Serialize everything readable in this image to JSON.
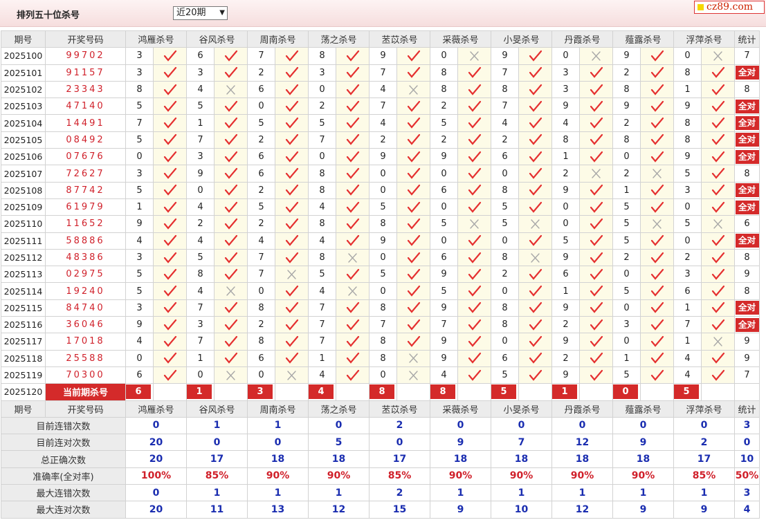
{
  "title": "排列五十位杀号",
  "period_select": {
    "value": "近20期",
    "options": [
      "近20期"
    ]
  },
  "site_badge": "cz89.com",
  "colors": {
    "accent": "#d42a2a",
    "draw_number": "#d0202a",
    "stat_value": "#1a2db0",
    "mark_bg": "#fdfbe7"
  },
  "headers": {
    "period": "期号",
    "draw": "开奖号码",
    "experts": [
      "鸿雁杀号",
      "谷风杀号",
      "周南杀号",
      "荡之杀号",
      "苤苡杀号",
      "采薇杀号",
      "小旻杀号",
      "丹霞杀号",
      "薤露杀号",
      "浮萍杀号"
    ],
    "count": "统计"
  },
  "rows": [
    {
      "period": "2025100",
      "draw": "99702",
      "kills": [
        3,
        6,
        7,
        8,
        9,
        0,
        9,
        0,
        9,
        0
      ],
      "hits": [
        1,
        1,
        1,
        1,
        1,
        0,
        1,
        0,
        1,
        0
      ],
      "count": "7"
    },
    {
      "period": "2025101",
      "draw": "91157",
      "kills": [
        3,
        3,
        2,
        3,
        7,
        8,
        7,
        3,
        2,
        8
      ],
      "hits": [
        1,
        1,
        1,
        1,
        1,
        1,
        1,
        1,
        1,
        1
      ],
      "count": "全对"
    },
    {
      "period": "2025102",
      "draw": "23343",
      "kills": [
        8,
        4,
        6,
        0,
        4,
        8,
        8,
        3,
        8,
        1
      ],
      "hits": [
        1,
        0,
        1,
        1,
        0,
        1,
        1,
        1,
        1,
        1
      ],
      "count": "8"
    },
    {
      "period": "2025103",
      "draw": "47140",
      "kills": [
        5,
        5,
        0,
        2,
        7,
        2,
        7,
        9,
        9,
        9
      ],
      "hits": [
        1,
        1,
        1,
        1,
        1,
        1,
        1,
        1,
        1,
        1
      ],
      "count": "全对"
    },
    {
      "period": "2025104",
      "draw": "14491",
      "kills": [
        7,
        1,
        5,
        5,
        4,
        5,
        4,
        4,
        2,
        8
      ],
      "hits": [
        1,
        1,
        1,
        1,
        1,
        1,
        1,
        1,
        1,
        1
      ],
      "count": "全对"
    },
    {
      "period": "2025105",
      "draw": "08492",
      "kills": [
        5,
        7,
        2,
        7,
        2,
        2,
        2,
        8,
        8,
        8
      ],
      "hits": [
        1,
        1,
        1,
        1,
        1,
        1,
        1,
        1,
        1,
        1
      ],
      "count": "全对"
    },
    {
      "period": "2025106",
      "draw": "07676",
      "kills": [
        0,
        3,
        6,
        0,
        9,
        9,
        6,
        1,
        0,
        9
      ],
      "hits": [
        1,
        1,
        1,
        1,
        1,
        1,
        1,
        1,
        1,
        1
      ],
      "count": "全对"
    },
    {
      "period": "2025107",
      "draw": "72627",
      "kills": [
        3,
        9,
        6,
        8,
        0,
        0,
        0,
        2,
        2,
        5
      ],
      "hits": [
        1,
        1,
        1,
        1,
        1,
        1,
        1,
        0,
        0,
        1
      ],
      "count": "8"
    },
    {
      "period": "2025108",
      "draw": "87742",
      "kills": [
        5,
        0,
        2,
        8,
        0,
        6,
        8,
        9,
        1,
        3
      ],
      "hits": [
        1,
        1,
        1,
        1,
        1,
        1,
        1,
        1,
        1,
        1
      ],
      "count": "全对"
    },
    {
      "period": "2025109",
      "draw": "61979",
      "kills": [
        1,
        4,
        5,
        4,
        5,
        0,
        5,
        0,
        5,
        0
      ],
      "hits": [
        1,
        1,
        1,
        1,
        1,
        1,
        1,
        1,
        1,
        1
      ],
      "count": "全对"
    },
    {
      "period": "2025110",
      "draw": "11652",
      "kills": [
        9,
        2,
        2,
        8,
        8,
        5,
        5,
        0,
        5,
        5
      ],
      "hits": [
        1,
        1,
        1,
        1,
        1,
        0,
        0,
        1,
        0,
        0
      ],
      "count": "6"
    },
    {
      "period": "2025111",
      "draw": "58886",
      "kills": [
        4,
        4,
        4,
        4,
        9,
        0,
        0,
        5,
        5,
        0
      ],
      "hits": [
        1,
        1,
        1,
        1,
        1,
        1,
        1,
        1,
        1,
        1
      ],
      "count": "全对"
    },
    {
      "period": "2025112",
      "draw": "48386",
      "kills": [
        3,
        5,
        7,
        8,
        0,
        6,
        8,
        9,
        2,
        2
      ],
      "hits": [
        1,
        1,
        1,
        0,
        1,
        1,
        0,
        1,
        1,
        1
      ],
      "count": "8"
    },
    {
      "period": "2025113",
      "draw": "02975",
      "kills": [
        5,
        8,
        7,
        5,
        5,
        9,
        2,
        6,
        0,
        3
      ],
      "hits": [
        1,
        1,
        0,
        1,
        1,
        1,
        1,
        1,
        1,
        1
      ],
      "count": "9"
    },
    {
      "period": "2025114",
      "draw": "19240",
      "kills": [
        5,
        4,
        0,
        4,
        0,
        5,
        0,
        1,
        5,
        6
      ],
      "hits": [
        1,
        0,
        1,
        0,
        1,
        1,
        1,
        1,
        1,
        1
      ],
      "count": "8"
    },
    {
      "period": "2025115",
      "draw": "84740",
      "kills": [
        3,
        7,
        8,
        7,
        8,
        9,
        8,
        9,
        0,
        1
      ],
      "hits": [
        1,
        1,
        1,
        1,
        1,
        1,
        1,
        1,
        1,
        1
      ],
      "count": "全对"
    },
    {
      "period": "2025116",
      "draw": "36046",
      "kills": [
        9,
        3,
        2,
        7,
        7,
        7,
        8,
        2,
        3,
        7
      ],
      "hits": [
        1,
        1,
        1,
        1,
        1,
        1,
        1,
        1,
        1,
        1
      ],
      "count": "全对"
    },
    {
      "period": "2025117",
      "draw": "17018",
      "kills": [
        4,
        7,
        8,
        7,
        8,
        9,
        0,
        9,
        0,
        1
      ],
      "hits": [
        1,
        1,
        1,
        1,
        1,
        1,
        1,
        1,
        1,
        0
      ],
      "count": "9"
    },
    {
      "period": "2025118",
      "draw": "25588",
      "kills": [
        0,
        1,
        6,
        1,
        8,
        9,
        6,
        2,
        1,
        4
      ],
      "hits": [
        1,
        1,
        1,
        1,
        0,
        1,
        1,
        1,
        1,
        1
      ],
      "count": "9"
    },
    {
      "period": "2025119",
      "draw": "70300",
      "kills": [
        6,
        0,
        0,
        4,
        0,
        4,
        5,
        9,
        5,
        4
      ],
      "hits": [
        1,
        0,
        0,
        1,
        0,
        1,
        1,
        1,
        1,
        1
      ],
      "count": "7"
    }
  ],
  "current": {
    "period": "2025120",
    "label": "当前期杀号",
    "kills": [
      "6",
      "1",
      "3",
      "4",
      "8",
      "8",
      "5",
      "1",
      "0",
      "5"
    ]
  },
  "stats": [
    {
      "label": "目前连错次数",
      "values": [
        "0",
        "1",
        "1",
        "0",
        "2",
        "0",
        "0",
        "0",
        "0",
        "0"
      ],
      "count": "3"
    },
    {
      "label": "目前连对次数",
      "values": [
        "20",
        "0",
        "0",
        "5",
        "0",
        "9",
        "7",
        "12",
        "9",
        "2"
      ],
      "count": "0"
    },
    {
      "label": "总正确次数",
      "values": [
        "20",
        "17",
        "18",
        "18",
        "17",
        "18",
        "18",
        "18",
        "18",
        "17"
      ],
      "count": "10"
    },
    {
      "label": "准确率(全对率)",
      "values": [
        "100%",
        "85%",
        "90%",
        "90%",
        "85%",
        "90%",
        "90%",
        "90%",
        "90%",
        "85%"
      ],
      "count": "50%",
      "red": true
    },
    {
      "label": "最大连错次数",
      "values": [
        "0",
        "1",
        "1",
        "1",
        "2",
        "1",
        "1",
        "1",
        "1",
        "1"
      ],
      "count": "3"
    },
    {
      "label": "最大连对次数",
      "values": [
        "20",
        "11",
        "13",
        "12",
        "15",
        "9",
        "10",
        "12",
        "9",
        "9"
      ],
      "count": "4"
    }
  ],
  "icons": {
    "hit": "check-icon",
    "miss": "cross-icon"
  }
}
